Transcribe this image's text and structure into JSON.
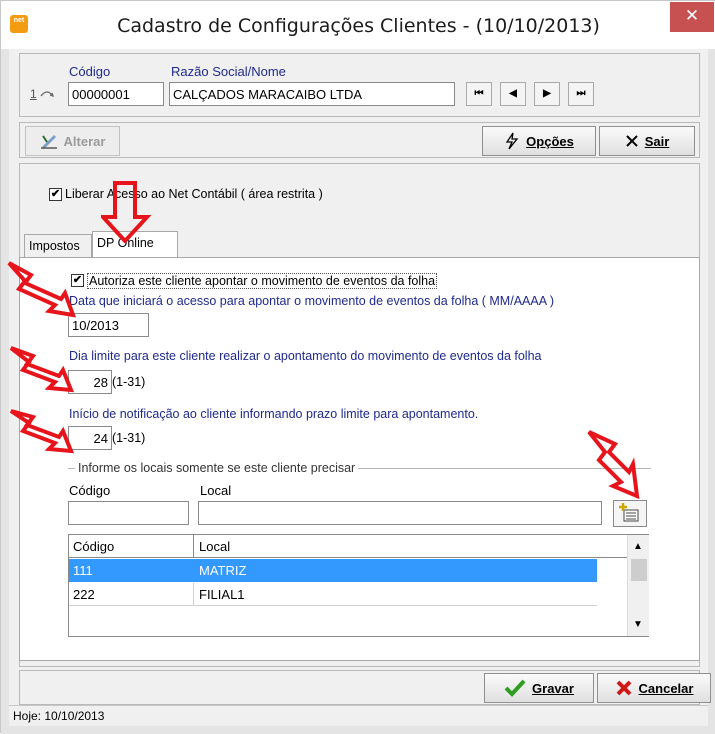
{
  "window": {
    "title": "Cadastro de Configurações Clientes - (10/10/2013)",
    "app_icon_text": "net",
    "close_glyph": "✕"
  },
  "header": {
    "record_index": "1",
    "codigo_label": "Código",
    "codigo_value": "00000001",
    "razao_label": "Razão Social/Nome",
    "razao_value": "CALÇADOS MARACAIBO LTDA",
    "nav_first": "⏮",
    "nav_prev": "◀",
    "nav_next": "▶",
    "nav_last": "⏭"
  },
  "toolbar": {
    "alterar_label": "Alterar",
    "opcoes_label": "Opções",
    "sair_label": "Sair"
  },
  "options": {
    "liberar_label": "Liberar Acesso ao Net Contábil ( área restrita )",
    "liberar_checked": true
  },
  "tabs": [
    {
      "label": "Impostos"
    },
    {
      "label": "DP Online"
    }
  ],
  "dp_online": {
    "autoriza_label": "Autoriza este cliente apontar o movimento de eventos da folha",
    "autoriza_checked": true,
    "data_inicio_label": "Data que iniciará o acesso para apontar o movimento de eventos da folha ( MM/AAAA )",
    "data_inicio_value": "10/2013",
    "dia_limite_label": "Dia limite para este cliente realizar o apontamento do movimento de eventos da folha",
    "dia_limite_value": "28",
    "dia_limite_range": "(1-31)",
    "notificacao_label": "Início de notificação ao  cliente informando prazo limite para apontamento.",
    "notificacao_value": "24",
    "notificacao_range": "(1-31)",
    "locais_group_label": "Informe os locais somente se este cliente precisar",
    "local_codigo_label": "Código",
    "local_label": "Local",
    "local_codigo_value": "",
    "local_value": "",
    "table": {
      "columns": [
        "Código",
        "Local"
      ],
      "rows": [
        {
          "codigo": "111",
          "local": "MATRIZ",
          "selected": true
        },
        {
          "codigo": "222",
          "local": "FILIAL1",
          "selected": false
        }
      ]
    }
  },
  "footer": {
    "gravar_label": "Gravar",
    "cancelar_label": "Cancelar"
  },
  "status": {
    "hoje_text": "Hoje: 10/10/2013"
  },
  "colors": {
    "selection": "#3399ff",
    "label_blue": "#1f2a8f",
    "annotation_red": "#e8141b",
    "close_red": "#c75050"
  }
}
